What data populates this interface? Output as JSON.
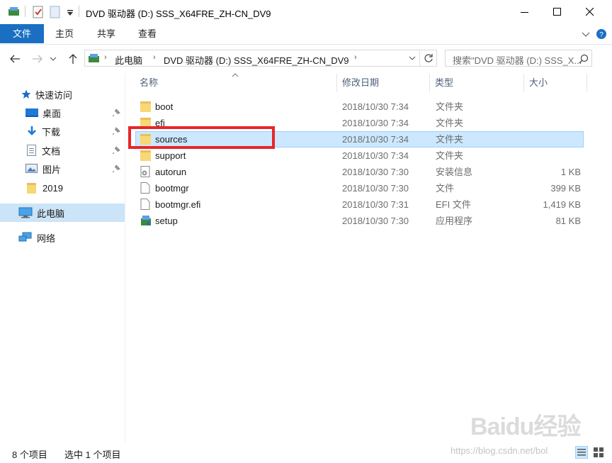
{
  "window": {
    "title": "DVD 驱动器 (D:) SSS_X64FRE_ZH-CN_DV9"
  },
  "ribbon": {
    "tabs": [
      "文件",
      "主页",
      "共享",
      "查看"
    ]
  },
  "address": {
    "segments": [
      "此电脑",
      "DVD 驱动器 (D:) SSS_X64FRE_ZH-CN_DV9"
    ],
    "search_placeholder": "搜索\"DVD 驱动器 (D:) SSS_X..."
  },
  "nav": {
    "quick_access": "快速访问",
    "items": [
      "桌面",
      "下载",
      "文档",
      "图片",
      "2019"
    ],
    "this_pc": "此电脑",
    "network": "网络"
  },
  "columns": {
    "name": "名称",
    "date": "修改日期",
    "type": "类型",
    "size": "大小"
  },
  "files": [
    {
      "name": "boot",
      "date": "2018/10/30 7:34",
      "type": "文件夹",
      "size": "",
      "icon": "folder-icon"
    },
    {
      "name": "efi",
      "date": "2018/10/30 7:34",
      "type": "文件夹",
      "size": "",
      "icon": "folder-icon"
    },
    {
      "name": "sources",
      "date": "2018/10/30 7:34",
      "type": "文件夹",
      "size": "",
      "icon": "folder-icon"
    },
    {
      "name": "support",
      "date": "2018/10/30 7:34",
      "type": "文件夹",
      "size": "",
      "icon": "folder-icon"
    },
    {
      "name": "autorun",
      "date": "2018/10/30 7:30",
      "type": "安装信息",
      "size": "1 KB",
      "icon": "settings-file-icon"
    },
    {
      "name": "bootmgr",
      "date": "2018/10/30 7:30",
      "type": "文件",
      "size": "399 KB",
      "icon": "file-icon"
    },
    {
      "name": "bootmgr.efi",
      "date": "2018/10/30 7:31",
      "type": "EFI 文件",
      "size": "1,419 KB",
      "icon": "file-icon"
    },
    {
      "name": "setup",
      "date": "2018/10/30 7:30",
      "type": "应用程序",
      "size": "81 KB",
      "icon": "setup-app-icon"
    }
  ],
  "status": {
    "count": "8 个项目",
    "selected": "选中 1 个项目"
  },
  "watermark": {
    "logo": "Baidu经验",
    "url": "https://blog.csdn.net/bol"
  },
  "colors": {
    "accent": "#1a6fc2",
    "selection": "#cce8ff",
    "highlight": "#e8262a",
    "folder": "#f8d775"
  }
}
